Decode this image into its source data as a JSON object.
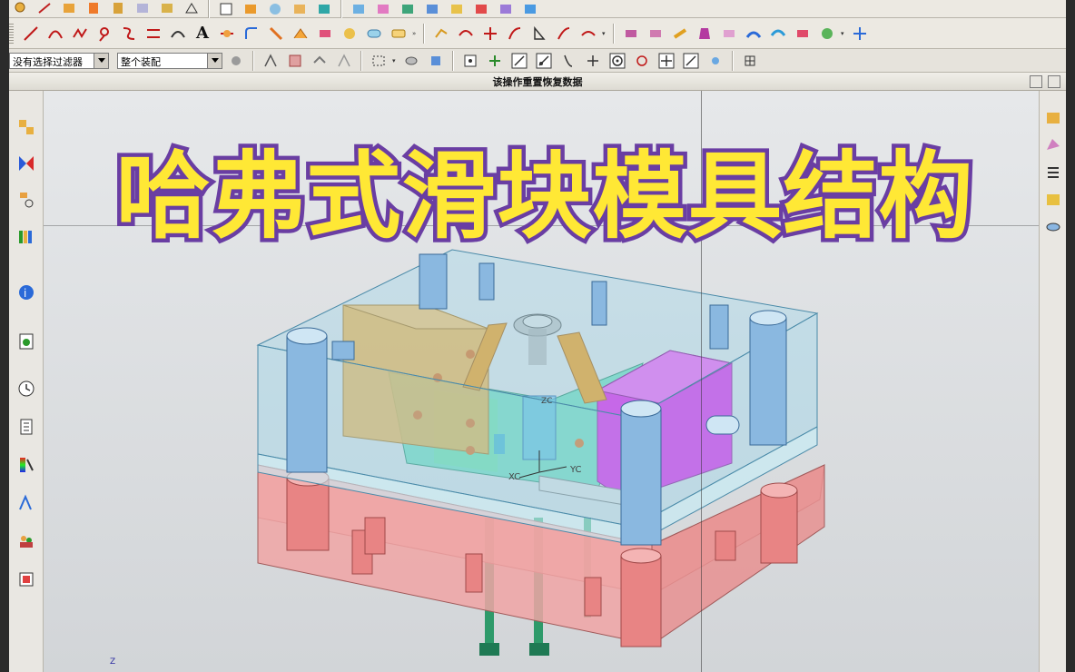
{
  "toolbar": {
    "selection_filter": "没有选择过滤器",
    "assembly_scope": "整个装配",
    "text_tool_label": "A"
  },
  "status": {
    "message": "该操作重置恢复数据"
  },
  "overlay": {
    "title": "哈弗式滑块模具结构"
  },
  "viewport": {
    "labels": {
      "xc": "XC",
      "yc": "YC",
      "zc": "ZC",
      "z_axis": "Z"
    }
  },
  "colors": {
    "top_plate": "#9fd6ea",
    "bottom_plate": "#f0a5a5",
    "slider_left": "#f2a93a",
    "slider_right": "#e01ee6",
    "core": "#44d6a8",
    "pins": "#2e9a6a",
    "title_fill": "#ffe835",
    "title_outline": "#6a3ea3"
  }
}
